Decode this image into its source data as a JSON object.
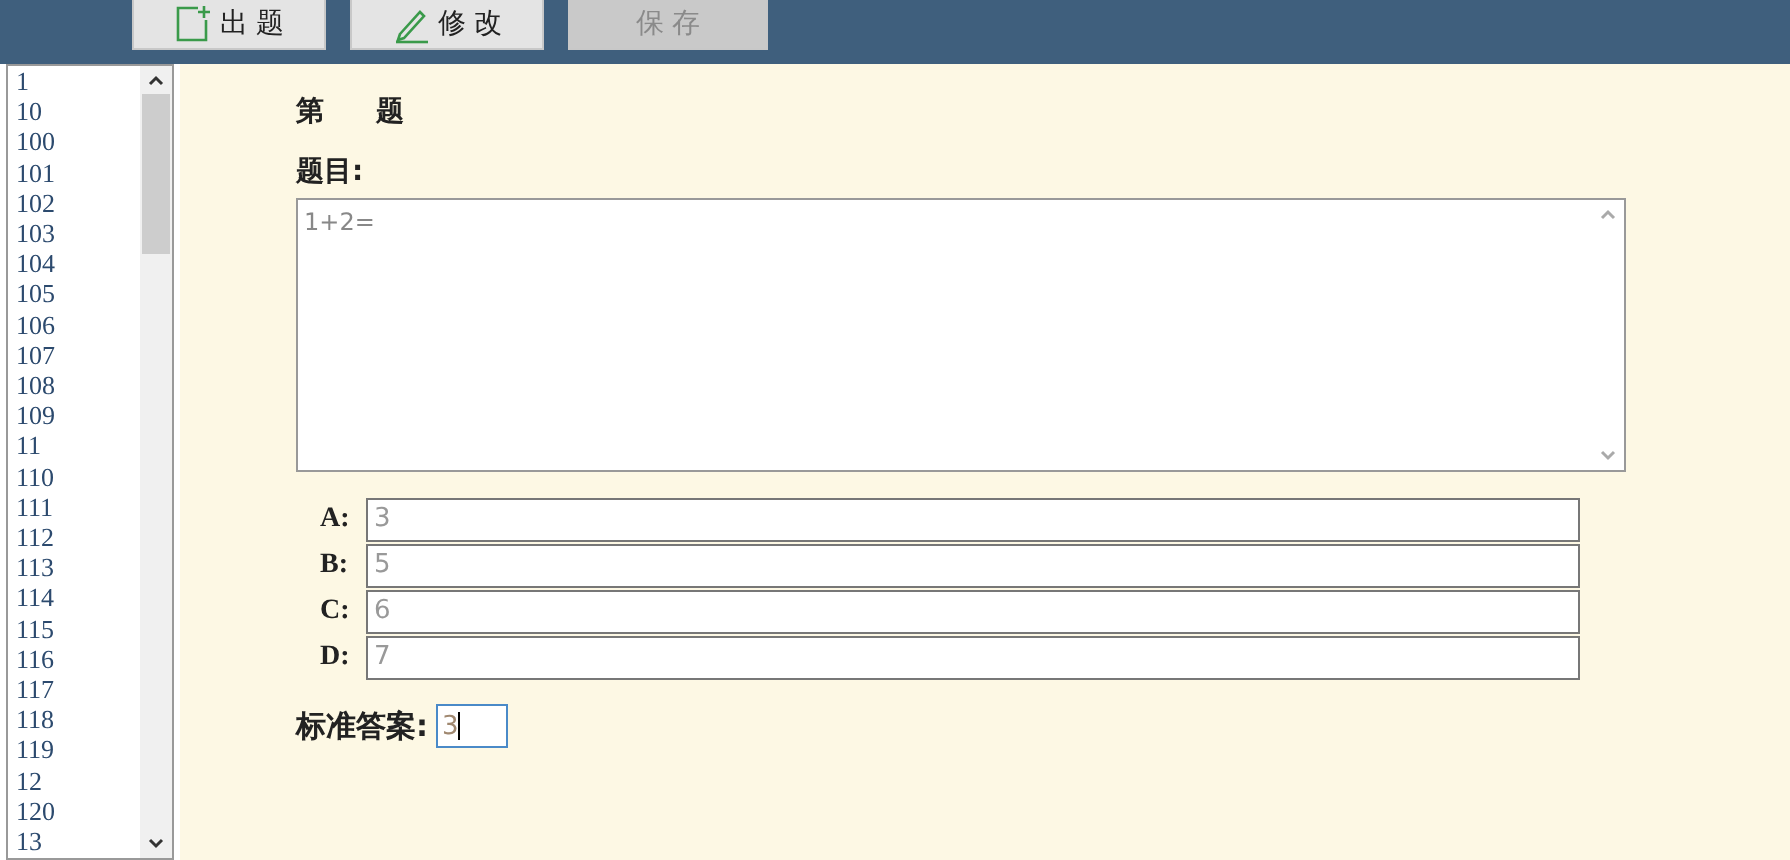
{
  "toolbar": {
    "buttons": [
      {
        "label": "出 题",
        "kind": "new",
        "disabled": false
      },
      {
        "label": "修 改",
        "kind": "edit",
        "disabled": false
      },
      {
        "label": "保 存",
        "kind": "plain",
        "disabled": true
      }
    ]
  },
  "question_list": {
    "items": [
      "1",
      "10",
      "100",
      "101",
      "102",
      "103",
      "104",
      "105",
      "106",
      "107",
      "108",
      "109",
      "11",
      "110",
      "111",
      "112",
      "113",
      "114",
      "115",
      "116",
      "117",
      "118",
      "119",
      "12",
      "120",
      "13"
    ]
  },
  "editor": {
    "heading_prefix": "第",
    "heading_suffix": "题",
    "question_label": "题目:",
    "question_value": "1+2=",
    "options": [
      {
        "label": "A:",
        "value": "3"
      },
      {
        "label": "B:",
        "value": "5"
      },
      {
        "label": "C:",
        "value": "6"
      },
      {
        "label": "D:",
        "value": "7"
      }
    ],
    "answer_label": "标准答案:",
    "answer_value": "3"
  }
}
